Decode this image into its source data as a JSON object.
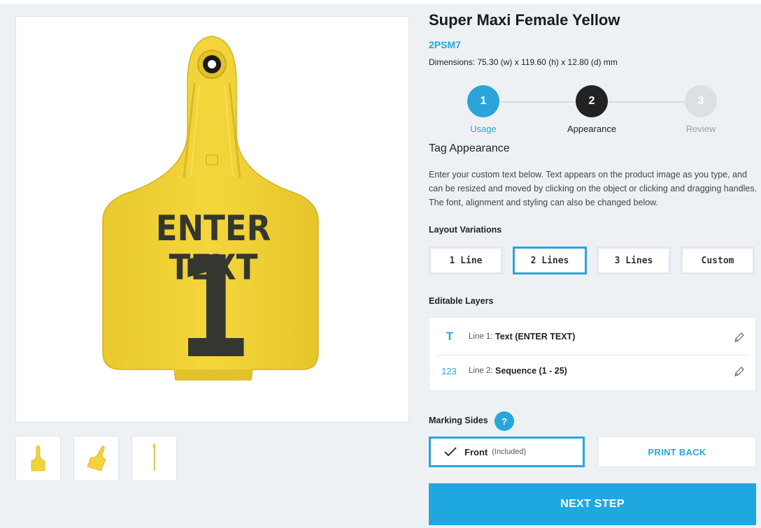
{
  "product": {
    "title": "Super Maxi Female Yellow",
    "sku": "2PSM7",
    "dimensions": "Dimensions: 75.30 (w) x 119.60 (h) x 12.80 (d) mm"
  },
  "tag_preview": {
    "line1_text": "ENTER TEXT",
    "line2_text": "1",
    "tag_color": "#f2d33a",
    "text_color": "#34372f"
  },
  "thumbnails": [
    {
      "icon": "tag-front-thumbnail"
    },
    {
      "icon": "tag-angled-thumbnail"
    },
    {
      "icon": "tag-side-thumbnail"
    }
  ],
  "steps": [
    {
      "number": "1",
      "label": "Usage",
      "state": "completed",
      "color": "#2aa5db"
    },
    {
      "number": "2",
      "label": "Appearance",
      "state": "current",
      "color": "#222222"
    },
    {
      "number": "3",
      "label": "Review",
      "state": "upcoming",
      "color": "#dcdfe3"
    }
  ],
  "section_title": "Tag Appearance",
  "description": "Enter your custom text below. Text appears on the product image as you type, and can be resized and moved by clicking on the object or clicking and dragging handles. The font, alignment and styling can also be changed below.",
  "layout_variations": {
    "label": "Layout Variations",
    "options": [
      "1 Line",
      "2 Lines",
      "3 Lines",
      "Custom"
    ],
    "selected": "2 Lines"
  },
  "editable_layers": {
    "label": "Editable Layers",
    "layers": [
      {
        "icon_text": "T",
        "prefix": "Line 1:",
        "value": "Text (ENTER TEXT)"
      },
      {
        "icon_text": "123",
        "prefix": "Line 2:",
        "value": "Sequence (1 - 25)"
      }
    ]
  },
  "marking_sides": {
    "label": "Marking Sides",
    "help": "?",
    "front_label": "Front",
    "front_note": "(Included)",
    "print_back": "PRINT BACK"
  },
  "next_step": "NEXT STEP",
  "accent_color": "#2aa5db"
}
